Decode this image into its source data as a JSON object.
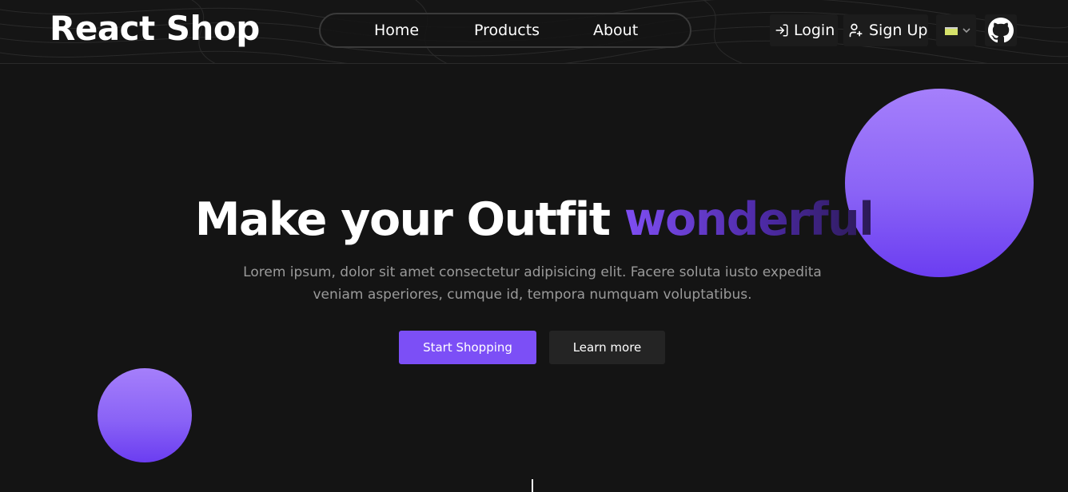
{
  "header": {
    "brand": "React Shop",
    "nav": [
      {
        "label": "Home"
      },
      {
        "label": "Products"
      },
      {
        "label": "About"
      }
    ],
    "login_label": "Login",
    "signup_label": "Sign Up",
    "login_icon": "login-icon",
    "signup_icon": "user-plus-icon",
    "language_icon": "flag-icon",
    "github_icon": "github-icon"
  },
  "hero": {
    "title_main": "Make your Outfit",
    "title_highlight": "wonderful",
    "subtitle": "Lorem ipsum, dolor sit amet consectetur adipisicing elit. Facere soluta iusto expedita veniam asperiores, cumque id, tempora numquam voluptatibus.",
    "primary_button": "Start Shopping",
    "secondary_button": "Learn more"
  },
  "colors": {
    "background": "#141414",
    "accent": "#7c4ff6",
    "accent_light": "#a57ffb",
    "secondary_button": "#242424",
    "muted_text": "#9a9a9a"
  }
}
